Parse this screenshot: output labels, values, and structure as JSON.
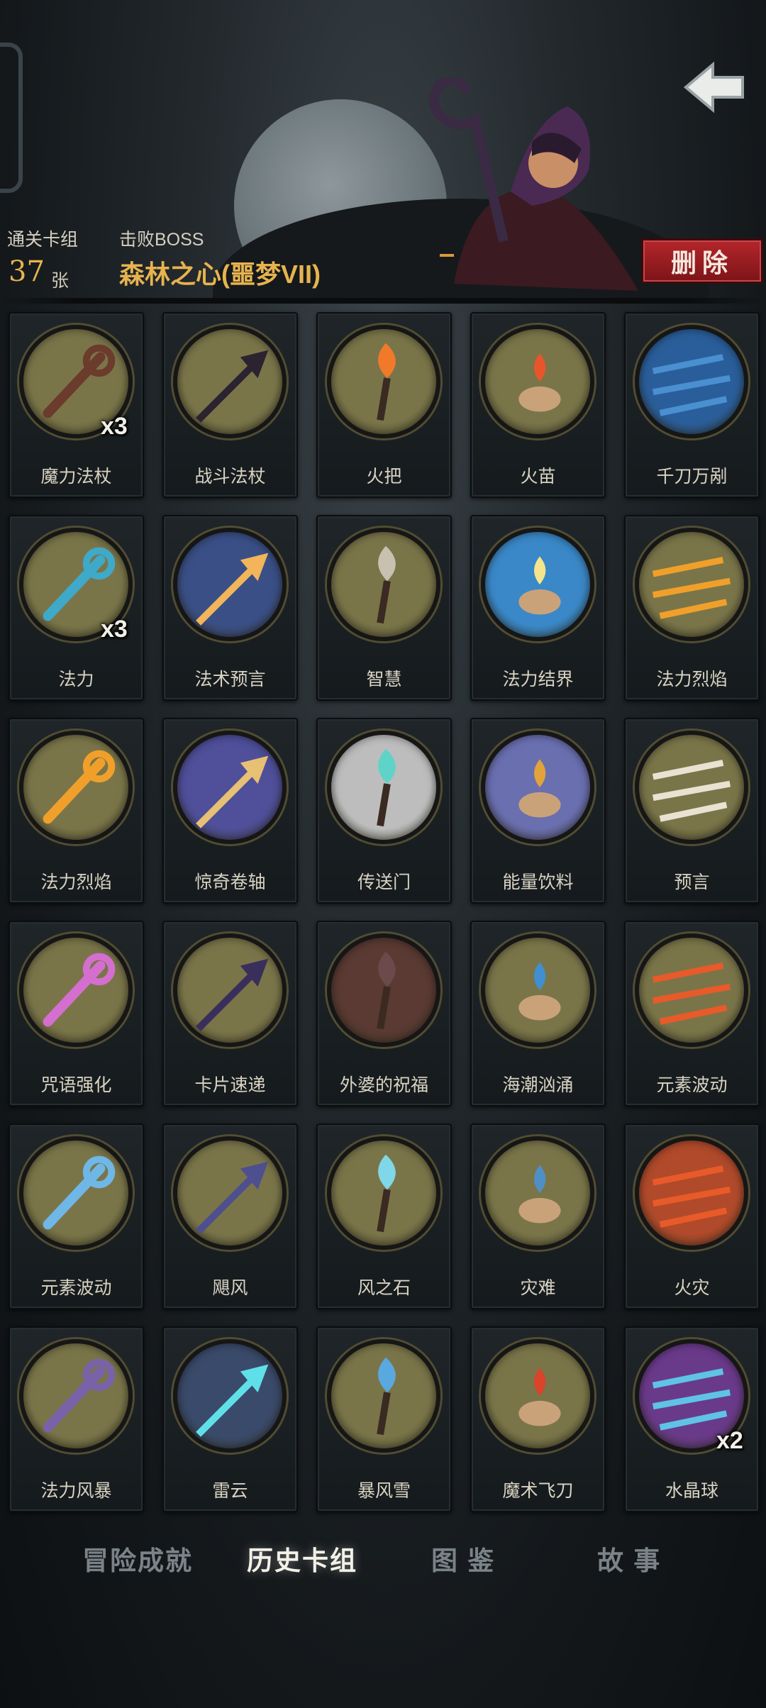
{
  "header": {
    "deck_label": "通关卡组",
    "deck_count": "37",
    "deck_unit": "张",
    "boss_label": "击败BOSS",
    "boss_name": "森林之心(噩梦VII)",
    "delete_label": "删除"
  },
  "cards": [
    {
      "name": "魔力法杖",
      "count": "x3",
      "icon": "staff-icon",
      "fg": "#6b3b2c",
      "bg": "#7a7549"
    },
    {
      "name": "战斗法杖",
      "count": "",
      "icon": "battle-staff-icon",
      "fg": "#2b2330",
      "bg": "#7a7549"
    },
    {
      "name": "火把",
      "count": "",
      "icon": "torch-icon",
      "fg": "#f07a2a",
      "bg": "#7a7549"
    },
    {
      "name": "火苗",
      "count": "",
      "icon": "flame-hand-icon",
      "fg": "#e9552a",
      "bg": "#7a7549"
    },
    {
      "name": "千刀万剐",
      "count": "",
      "icon": "blades-icon",
      "fg": "#4a8fd0",
      "bg": "#2a5e9a"
    },
    {
      "name": "法力",
      "count": "x3",
      "icon": "mana-orb-icon",
      "fg": "#3fa9c9",
      "bg": "#7a7549"
    },
    {
      "name": "法术预言",
      "count": "",
      "icon": "prophecy-orb-icon",
      "fg": "#f2b55a",
      "bg": "#3a4f86"
    },
    {
      "name": "智慧",
      "count": "",
      "icon": "sage-icon",
      "fg": "#c8c1b0",
      "bg": "#7a7549"
    },
    {
      "name": "法力结界",
      "count": "",
      "icon": "barrier-icon",
      "fg": "#f2e58c",
      "bg": "#3a88c8"
    },
    {
      "name": "法力烈焰",
      "count": "",
      "icon": "mana-flame-icon",
      "fg": "#f0a02a",
      "bg": "#7a7549"
    },
    {
      "name": "法力烈焰",
      "count": "",
      "icon": "mana-flame-icon",
      "fg": "#f0a02a",
      "bg": "#7a7549"
    },
    {
      "name": "惊奇卷轴",
      "count": "",
      "icon": "scroll-icon",
      "fg": "#e8c074",
      "bg": "#4f4f9a"
    },
    {
      "name": "传送门",
      "count": "",
      "icon": "portal-icon",
      "fg": "#5fd3c8",
      "bg": "#bdbdbd"
    },
    {
      "name": "能量饮料",
      "count": "",
      "icon": "energy-drink-icon",
      "fg": "#e1a33a",
      "bg": "#6a6fb0"
    },
    {
      "name": "预言",
      "count": "",
      "icon": "prophet-icon",
      "fg": "#e9e2d2",
      "bg": "#7a7549"
    },
    {
      "name": "咒语强化",
      "count": "",
      "icon": "spell-crystal-icon",
      "fg": "#d46fcf",
      "bg": "#7a7549"
    },
    {
      "name": "卡片速递",
      "count": "",
      "icon": "card-delivery-icon",
      "fg": "#3a2f5a",
      "bg": "#7a7549"
    },
    {
      "name": "外婆的祝福",
      "count": "",
      "icon": "grandma-icon",
      "fg": "#6a4a4a",
      "bg": "#5a3a32"
    },
    {
      "name": "海潮汹涌",
      "count": "",
      "icon": "tidal-wave-icon",
      "fg": "#3f8fd1",
      "bg": "#7a7549"
    },
    {
      "name": "元素波动",
      "count": "",
      "icon": "elemental-wave-icon",
      "fg": "#e85a2a",
      "bg": "#7a7549"
    },
    {
      "name": "元素波动",
      "count": "",
      "icon": "elemental-wave-icon",
      "fg": "#6fb7e6",
      "bg": "#7a7549"
    },
    {
      "name": "飓风",
      "count": "",
      "icon": "tornado-icon",
      "fg": "#4e4f8e",
      "bg": "#7a7549"
    },
    {
      "name": "风之石",
      "count": "",
      "icon": "wind-stone-icon",
      "fg": "#7fd7e8",
      "bg": "#7a7549"
    },
    {
      "name": "灾难",
      "count": "",
      "icon": "disaster-wave-icon",
      "fg": "#4f8fc6",
      "bg": "#7a7549"
    },
    {
      "name": "火灾",
      "count": "",
      "icon": "wildfire-icon",
      "fg": "#e85a2a",
      "bg": "#b04a2a"
    },
    {
      "name": "法力风暴",
      "count": "",
      "icon": "mana-storm-icon",
      "fg": "#7a62a8",
      "bg": "#7a7549"
    },
    {
      "name": "雷云",
      "count": "",
      "icon": "thundercloud-icon",
      "fg": "#5fe0e8",
      "bg": "#3a4a6a"
    },
    {
      "name": "暴风雪",
      "count": "",
      "icon": "blizzard-icon",
      "fg": "#5aa8e0",
      "bg": "#7a7549"
    },
    {
      "name": "魔术飞刀",
      "count": "",
      "icon": "clown-knife-icon",
      "fg": "#d9442a",
      "bg": "#7a7549"
    },
    {
      "name": "水晶球",
      "count": "x2",
      "icon": "crystal-ball-icon",
      "fg": "#5fc3e6",
      "bg": "#6a3a8a"
    }
  ],
  "tabs": [
    {
      "label": "冒险成就",
      "active": false
    },
    {
      "label": "历史卡组",
      "active": true
    },
    {
      "label": "图 鉴",
      "active": false
    },
    {
      "label": "故 事",
      "active": false
    }
  ]
}
